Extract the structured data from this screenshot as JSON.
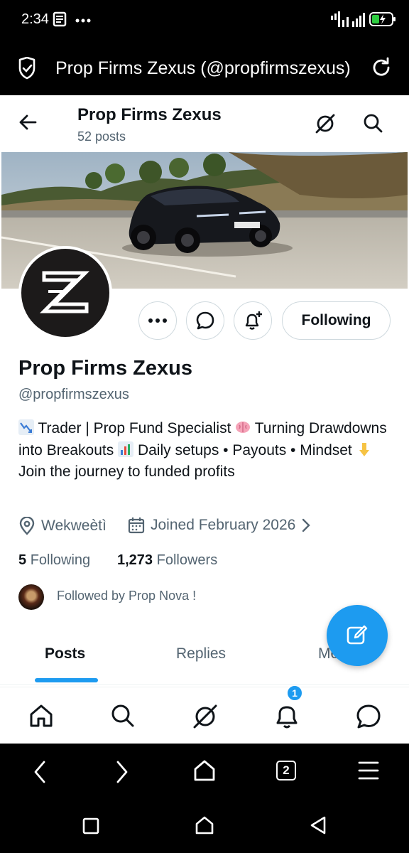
{
  "status_bar": {
    "time": "2:34",
    "icons": [
      "notes-icon",
      "more-dots-icon",
      "signal-icon",
      "battery-icon"
    ]
  },
  "browser": {
    "page_title": "Prop Firms Zexus (@propfirmszexus)"
  },
  "header": {
    "title": "Prop Firms Zexus",
    "subtitle": "52 posts"
  },
  "profile": {
    "name": "Prop Firms Zexus",
    "handle": "@propfirmszexus",
    "bio_parts": [
      "Trader | Prop Fund Specialist",
      "Turning Drawdowns into Breakouts",
      "Daily setups • Payouts • Mindset",
      "Join the journey to funded profits"
    ],
    "location": "Wekweètì",
    "joined": "Joined February 2026",
    "following_count": "5",
    "following_label": "Following",
    "followers_count": "1,273",
    "followers_label": "Followers",
    "followed_by": "Followed by Prop Nova !",
    "follow_button": "Following"
  },
  "tabs": [
    {
      "label": "Posts",
      "active": true
    },
    {
      "label": "Replies",
      "active": false
    },
    {
      "label": "Media",
      "active": false
    }
  ],
  "notifications_badge": "1",
  "browser_tabs_count": "2",
  "colors": {
    "accent": "#1d9bf0",
    "text": "#0f1419",
    "muted": "#536471"
  }
}
